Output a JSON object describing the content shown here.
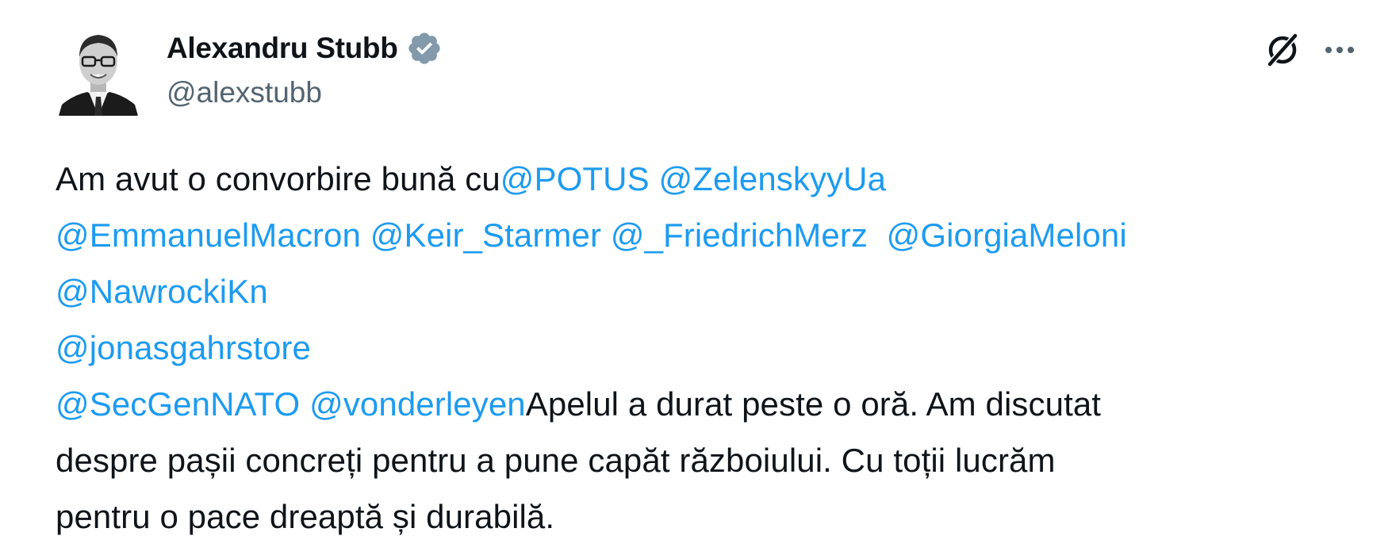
{
  "author": {
    "name": "Alexandru Stubb",
    "handle": "@alexstubb",
    "verified_icon": "verified-badge-icon",
    "verified_color": "#829aab"
  },
  "actions": {
    "grok_icon": "grok-icon",
    "more_icon": "more-options-icon"
  },
  "colors": {
    "text": "#0f1419",
    "secondary": "#536471",
    "mention": "#1d9bf0"
  },
  "tweet": {
    "line1_text": "Am avut o convorbire bună cu",
    "mentions": {
      "potus": "@POTUS",
      "zelensky": "@ZelenskyyUa",
      "macron": "@EmmanuelMacron",
      "starmer": "@Keir_Starmer",
      "merz": "@_FriedrichMerz",
      "meloni": "@GiorgiaMeloni",
      "nawrocki": "@NawrockiKn",
      "store": "@jonasgahrstore",
      "nato": "@SecGenNATO",
      "vonderleyen": "@vonderleyen"
    },
    "line5_text": "Apelul a durat peste o oră. Am discutat",
    "line6_text": "despre pașii concreți pentru a pune capăt războiului. Cu toții lucrăm",
    "line7_text": "pentru o pace dreaptă și durabilă."
  }
}
